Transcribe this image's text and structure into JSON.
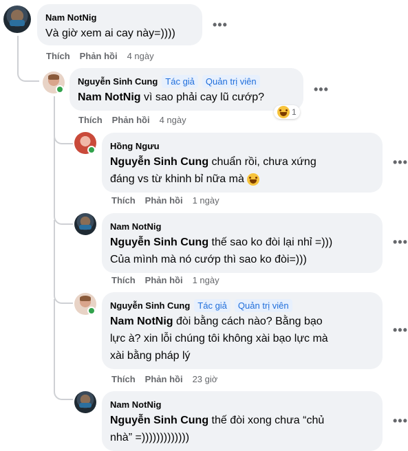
{
  "actions": {
    "like": "Thích",
    "reply": "Phản hồi"
  },
  "comments": [
    {
      "author": "Nam NotNig",
      "text": "Và giờ xem ai cay này=))))",
      "time": "4 ngày"
    },
    {
      "author": "Nguyễn Sinh Cung",
      "badges": [
        "Tác giả",
        "Quản trị viên"
      ],
      "mention": "Nam NotNig",
      "text": " vì sao phải cay lũ cướp?",
      "time": "4 ngày",
      "reaction": {
        "icon": "laughing-tears-emoji",
        "count": "1"
      }
    },
    {
      "author": "Hồng Ngưu",
      "mention": "Nguyễn Sinh Cung",
      "line1": " chuẩn rồi, chưa xứng",
      "line2": "đáng vs từ khinh bỉ nữa mà",
      "time": "1 ngày"
    },
    {
      "author": "Nam NotNig",
      "mention": "Nguyễn Sinh Cung",
      "line1": " thế sao ko đòi lại nhỉ =)))",
      "line2": "Của mình mà nó cướp thì sao ko đòi=)))",
      "time": "1 ngày"
    },
    {
      "author": "Nguyễn Sinh Cung",
      "badges": [
        "Tác giả",
        "Quản trị viên"
      ],
      "mention": "Nam NotNig",
      "line1": " đòi bằng cách nào? Bằng bạo",
      "line2": "lực à? xin lỗi chúng tôi không xài bạo lực mà",
      "line3": "xài bằng pháp lý",
      "time": "23 giờ"
    },
    {
      "author": "Nam NotNig",
      "mention": "Nguyễn Sinh Cung",
      "line1": " thế đòi xong chưa “chủ",
      "line2": "nhà” =)))))))))))))"
    }
  ]
}
